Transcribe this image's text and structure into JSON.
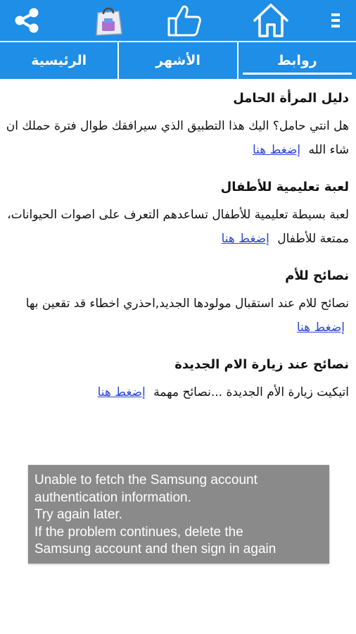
{
  "toolbar": {
    "icons": [
      "share-icon",
      "shopping-bag-icon",
      "thumbs-up-icon",
      "home-icon",
      "overflow-menu-icon"
    ],
    "accent": "#1e8ee6"
  },
  "tabs": [
    {
      "label": "روابط",
      "active": true
    },
    {
      "label": "الأشهر",
      "active": false
    },
    {
      "label": "الرئيسية",
      "active": false
    }
  ],
  "items": [
    {
      "title": "دليل المرأة الحامل",
      "desc": "هل انتي حامل؟ اليك هذا التطبيق الذي سيرافقك طوال فترة حملك ان شاء الله",
      "link": "إضغط هنا"
    },
    {
      "title": "لعبة تعليمية للأطفال",
      "desc": "لعبة بسيطة تعليمية للأطفال تساعدهم التعرف على اصوات الحيوانات، ممتعة للأطفال",
      "link": "إضغط هنا"
    },
    {
      "title": "نصائح للأم",
      "desc": "نصائح للام عند استقبال مولودها الجديد,احذري اخطاء قد تقعين بها",
      "link": "إضغط هنا"
    },
    {
      "title": "نصائح عند زيارة الام الجديدة",
      "desc": "اتيكيت زيارة الأم الجديدة ...نصائح مهمة",
      "link": "إضغط هنا"
    }
  ],
  "toast": {
    "lines": [
      "Unable to fetch the Samsung account",
      "authentication information.",
      "Try again later.",
      "If the problem continues, delete the",
      "Samsung account and then sign in again"
    ]
  }
}
